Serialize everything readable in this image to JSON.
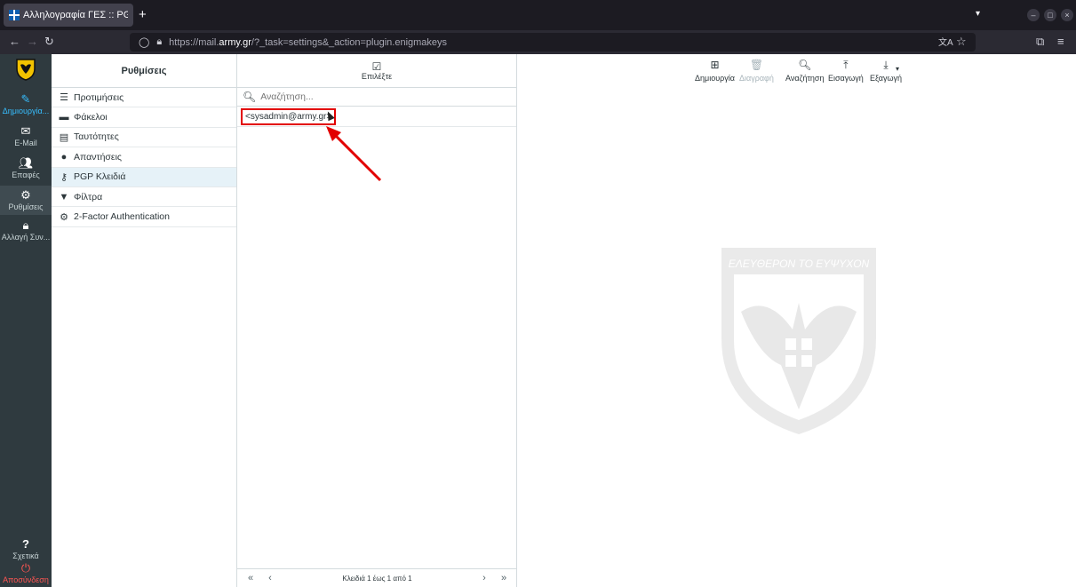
{
  "browser": {
    "tab_title": "Αλληλογραφία ΓΕΣ :: PGP ×",
    "new_tab": "+",
    "url_prefix": "https://mail.",
    "url_host": "army.gr",
    "url_path": "/?_task=settings&_action=plugin.enigmakeys"
  },
  "rail": {
    "items": [
      {
        "label": "Δημιουργία...",
        "icon": "pencil-square-icon"
      },
      {
        "label": "E-Mail",
        "icon": "envelope-icon"
      },
      {
        "label": "Επαφές",
        "icon": "users-icon"
      },
      {
        "label": "Ρυθμίσεις",
        "icon": "gear-icon"
      },
      {
        "label": "Αλλαγή Συν...",
        "icon": "lock-icon"
      }
    ],
    "about": "Σχετικά",
    "logout": "Αποσύνδεση"
  },
  "settings": {
    "header": "Ρυθμίσεις",
    "items": [
      {
        "label": "Προτιμήσεις",
        "icon": "sliders-icon"
      },
      {
        "label": "Φάκελοι",
        "icon": "folder-icon"
      },
      {
        "label": "Ταυτότητες",
        "icon": "id-card-icon"
      },
      {
        "label": "Απαντήσεις",
        "icon": "comment-icon"
      },
      {
        "label": "PGP Κλειδιά",
        "icon": "key-icon"
      },
      {
        "label": "Φίλτρα",
        "icon": "filter-icon"
      },
      {
        "label": "2-Factor Authentication",
        "icon": "cog-icon"
      }
    ],
    "selected_index": 4
  },
  "keys": {
    "select_label": "Επιλέξτε",
    "search_placeholder": "Αναζήτηση...",
    "rows": [
      "<sysadmin@army.gr>"
    ],
    "pager_info": "Κλειδιά 1 έως 1 από 1",
    "pager_first": "«",
    "pager_prev": "‹",
    "pager_next": "›",
    "pager_last": "»"
  },
  "toolbar": {
    "create": "Δημιουργία",
    "delete": "Διαγραφή",
    "search": "Αναζήτηση",
    "import": "Εισαγωγή",
    "export": "Εξαγωγή"
  },
  "watermark": {
    "motto": "ΕΛΕΥΘΕΡΟΝ ΤΟ ΕΥΨΥΧΟΝ"
  },
  "colors": {
    "rail_bg": "#2f3a3f",
    "accent": "#37beff",
    "highlight": "#e20000",
    "selected_bg": "#e6f2f8"
  }
}
